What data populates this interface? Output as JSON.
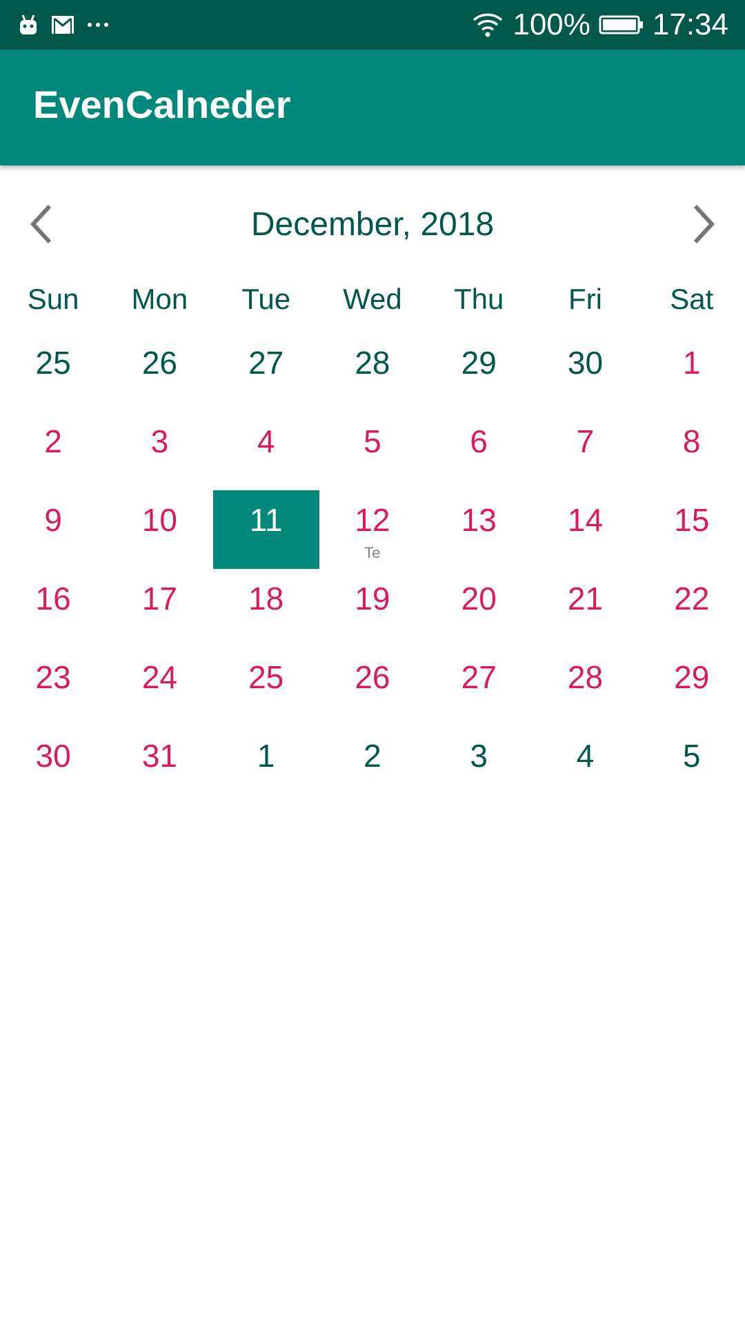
{
  "status_bar": {
    "battery": "100%",
    "time": "17:34",
    "icons": [
      "android-icon",
      "gmail-icon",
      "more-dots-icon",
      "wifi-icon",
      "battery-icon"
    ]
  },
  "app_bar": {
    "title": "EvenCalneder"
  },
  "calendar": {
    "month_label": "December, 2018",
    "prev_icon": "chevron-left-icon",
    "next_icon": "chevron-right-icon",
    "weekdays": [
      "Sun",
      "Mon",
      "Tue",
      "Wed",
      "Thu",
      "Fri",
      "Sat"
    ],
    "weeks": [
      [
        {
          "d": "25",
          "in": false
        },
        {
          "d": "26",
          "in": false
        },
        {
          "d": "27",
          "in": false
        },
        {
          "d": "28",
          "in": false
        },
        {
          "d": "29",
          "in": false
        },
        {
          "d": "30",
          "in": false
        },
        {
          "d": "1",
          "in": true
        }
      ],
      [
        {
          "d": "2",
          "in": true
        },
        {
          "d": "3",
          "in": true
        },
        {
          "d": "4",
          "in": true
        },
        {
          "d": "5",
          "in": true
        },
        {
          "d": "6",
          "in": true
        },
        {
          "d": "7",
          "in": true
        },
        {
          "d": "8",
          "in": true
        }
      ],
      [
        {
          "d": "9",
          "in": true
        },
        {
          "d": "10",
          "in": true
        },
        {
          "d": "11",
          "in": true,
          "selected": true
        },
        {
          "d": "12",
          "in": true,
          "note": "Te"
        },
        {
          "d": "13",
          "in": true
        },
        {
          "d": "14",
          "in": true
        },
        {
          "d": "15",
          "in": true
        }
      ],
      [
        {
          "d": "16",
          "in": true
        },
        {
          "d": "17",
          "in": true
        },
        {
          "d": "18",
          "in": true
        },
        {
          "d": "19",
          "in": true
        },
        {
          "d": "20",
          "in": true
        },
        {
          "d": "21",
          "in": true
        },
        {
          "d": "22",
          "in": true
        }
      ],
      [
        {
          "d": "23",
          "in": true
        },
        {
          "d": "24",
          "in": true
        },
        {
          "d": "25",
          "in": true
        },
        {
          "d": "26",
          "in": true
        },
        {
          "d": "27",
          "in": true
        },
        {
          "d": "28",
          "in": true
        },
        {
          "d": "29",
          "in": true
        }
      ],
      [
        {
          "d": "30",
          "in": true
        },
        {
          "d": "31",
          "in": true
        },
        {
          "d": "1",
          "in": false
        },
        {
          "d": "2",
          "in": false
        },
        {
          "d": "3",
          "in": false
        },
        {
          "d": "4",
          "in": false
        },
        {
          "d": "5",
          "in": false
        }
      ]
    ]
  },
  "colors": {
    "status_bar": "#00574b",
    "app_bar": "#00897b",
    "in_month_day": "#d81b60",
    "out_month_day": "#00574b",
    "selected_bg": "#00897b"
  }
}
